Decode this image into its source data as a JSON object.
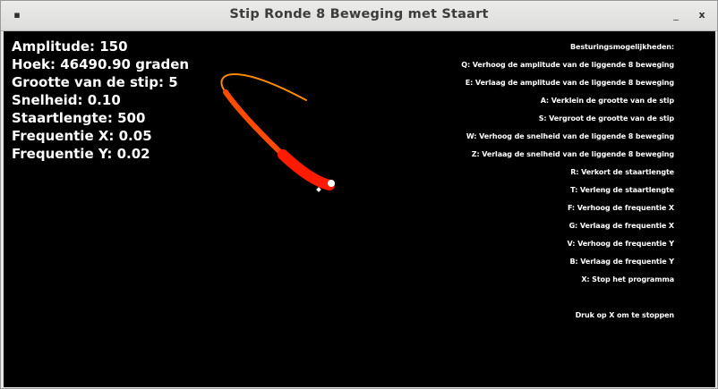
{
  "window": {
    "title": "Stip Ronde 8 Beweging met Staart",
    "menu_icon": "window-menu-icon",
    "minimize_glyph": "_",
    "close_glyph": "x"
  },
  "stats": {
    "amplitude": "Amplitude: 150",
    "angle": "Hoek: 46490.90 graden",
    "dot_size": "Grootte van de stip: 5",
    "speed": "Snelheid: 0.10",
    "tail_length": "Staartlengte: 500",
    "freq_x": "Frequentie X: 0.05",
    "freq_y": "Frequentie Y: 0.02"
  },
  "controls": {
    "header": "Besturingsmogelijkheden:",
    "items": [
      "Q: Verhoog de amplitude van de liggende 8 beweging",
      "E: Verlaag de amplitude van de liggende 8 beweging",
      "A: Verklein de grootte van de stip",
      "S: Vergroot de grootte van de stip",
      "W: Verhoog de snelheid van de liggende 8 beweging",
      "Z: Verlaag de snelheid van de liggende 8 beweging",
      "R: Verkort de staartlengte",
      "T: Verleng de staartlengte",
      "F: Verhoog de frequentie X",
      "G: Verlaag de frequentie X",
      "V: Verhoog de frequentie Y",
      "B: Verlaag de frequentie Y",
      "X: Stop het programma"
    ],
    "footer": "Druk op X om te stoppen"
  },
  "colors": {
    "background": "#000000",
    "text": "#ffffff",
    "tail_head": "#ff1a00",
    "tail_end": "#ff8c00",
    "dot": "#ffffff"
  }
}
